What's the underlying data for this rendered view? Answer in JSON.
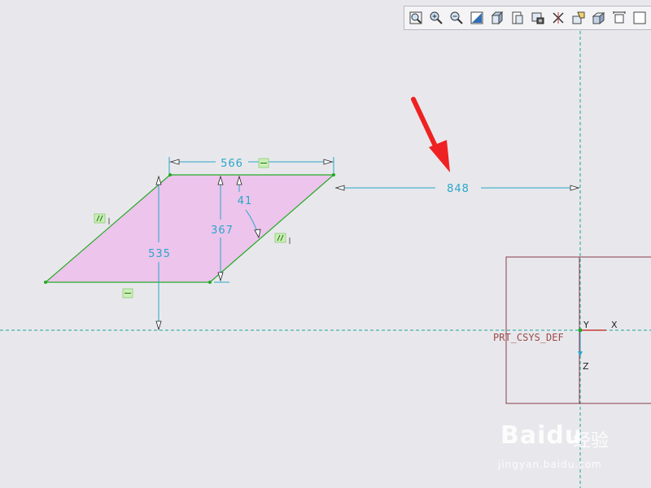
{
  "toolbar": {
    "buttons": [
      {
        "name": "refit-icon"
      },
      {
        "name": "zoom-in-icon"
      },
      {
        "name": "zoom-out-icon"
      },
      {
        "name": "repaint-icon"
      },
      {
        "name": "view-orient-icon"
      },
      {
        "name": "saved-views-icon"
      },
      {
        "name": "display-style-icon"
      },
      {
        "name": "datum-display-icon"
      },
      {
        "name": "sketch-display-icon"
      },
      {
        "name": "shading-icon"
      },
      {
        "name": "dimension-display-icon"
      },
      {
        "name": "more-icon"
      }
    ]
  },
  "sketch": {
    "dimensions": {
      "top_width": "566",
      "height": "367",
      "angle": "41",
      "offset_height": "535",
      "horizontal_offset": "848"
    },
    "constraint_labels": {
      "parallel": "//",
      "horizontal": "—"
    },
    "fill_color": "#ecc4ec",
    "edge_color": "#22aa22",
    "dimension_color": "#2aa6c9"
  },
  "csys": {
    "label": "PRT_CSYS_DEF",
    "x_label": "X",
    "y_label": "Y",
    "z_label": "Z"
  },
  "watermark": {
    "brand": "Baidu",
    "cn": "经验",
    "url": "jingyan.baidu.com"
  }
}
